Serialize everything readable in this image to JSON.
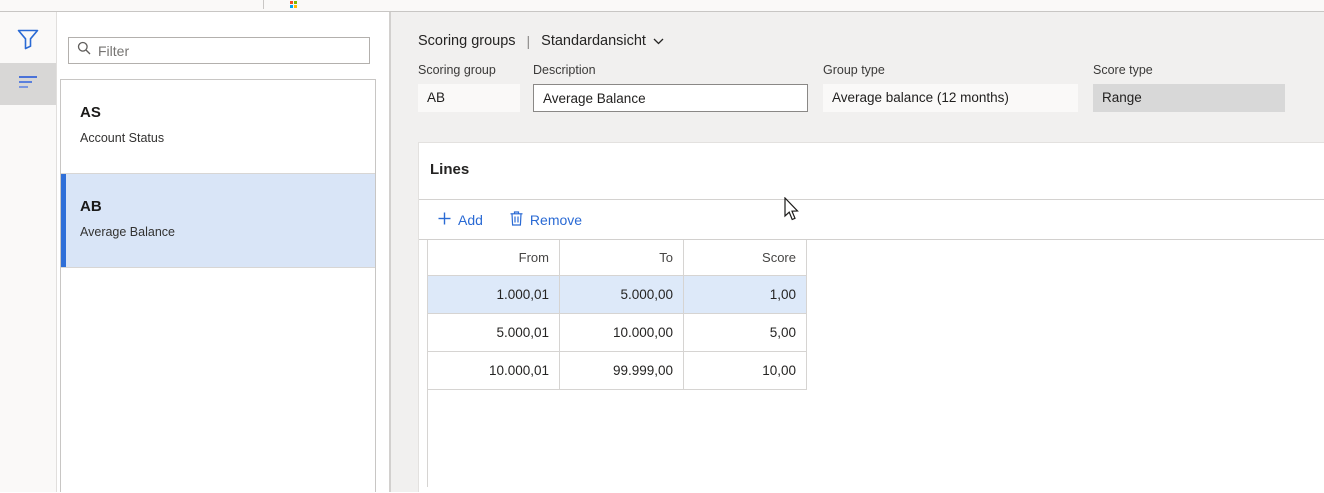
{
  "colors": {
    "accent_blue": "#2a6ad4",
    "selected_item_bg": "#d9e5f7",
    "selected_item_bar": "#2f6fd8",
    "selected_row_bg": "#dde9f9",
    "rail_selected_bg": "#d8d7d6",
    "main_bg": "#f1f0ef",
    "disabled_field_bg": "#d8d8d8",
    "readonly_field_bg": "#faf9f8"
  },
  "top_strip": {
    "logo_icon": "microsoft-logo"
  },
  "rail": {
    "filter_icon": "filter-funnel",
    "list_icon": "list-lines"
  },
  "sidebar": {
    "filter_placeholder": "Filter",
    "items": [
      {
        "code": "AS",
        "name": "Account Status",
        "selected": false
      },
      {
        "code": "AB",
        "name": "Average Balance",
        "selected": true
      }
    ]
  },
  "header": {
    "title": "Scoring groups",
    "separator": "|",
    "view_name": "Standardansicht",
    "view_chevron_icon": "chevron-down"
  },
  "form": {
    "fields": [
      {
        "label": "Scoring group",
        "value": "AB",
        "state": "readonly"
      },
      {
        "label": "Description",
        "value": "Average Balance",
        "state": "editable"
      },
      {
        "label": "Group type",
        "value": "Average balance (12 months)",
        "state": "readonly"
      },
      {
        "label": "Score type",
        "value": "Range",
        "state": "disabled"
      }
    ]
  },
  "lines": {
    "title": "Lines",
    "toolbar": {
      "add_label": "Add",
      "add_icon": "plus",
      "remove_label": "Remove",
      "remove_icon": "trash"
    },
    "table": {
      "columns": [
        "From",
        "To",
        "Score"
      ],
      "rows": [
        {
          "from": "1.000,01",
          "to": "5.000,00",
          "score": "1,00",
          "selected": true
        },
        {
          "from": "5.000,01",
          "to": "10.000,00",
          "score": "5,00",
          "selected": false
        },
        {
          "from": "10.000,01",
          "to": "99.999,00",
          "score": "10,00",
          "selected": false
        }
      ]
    }
  }
}
